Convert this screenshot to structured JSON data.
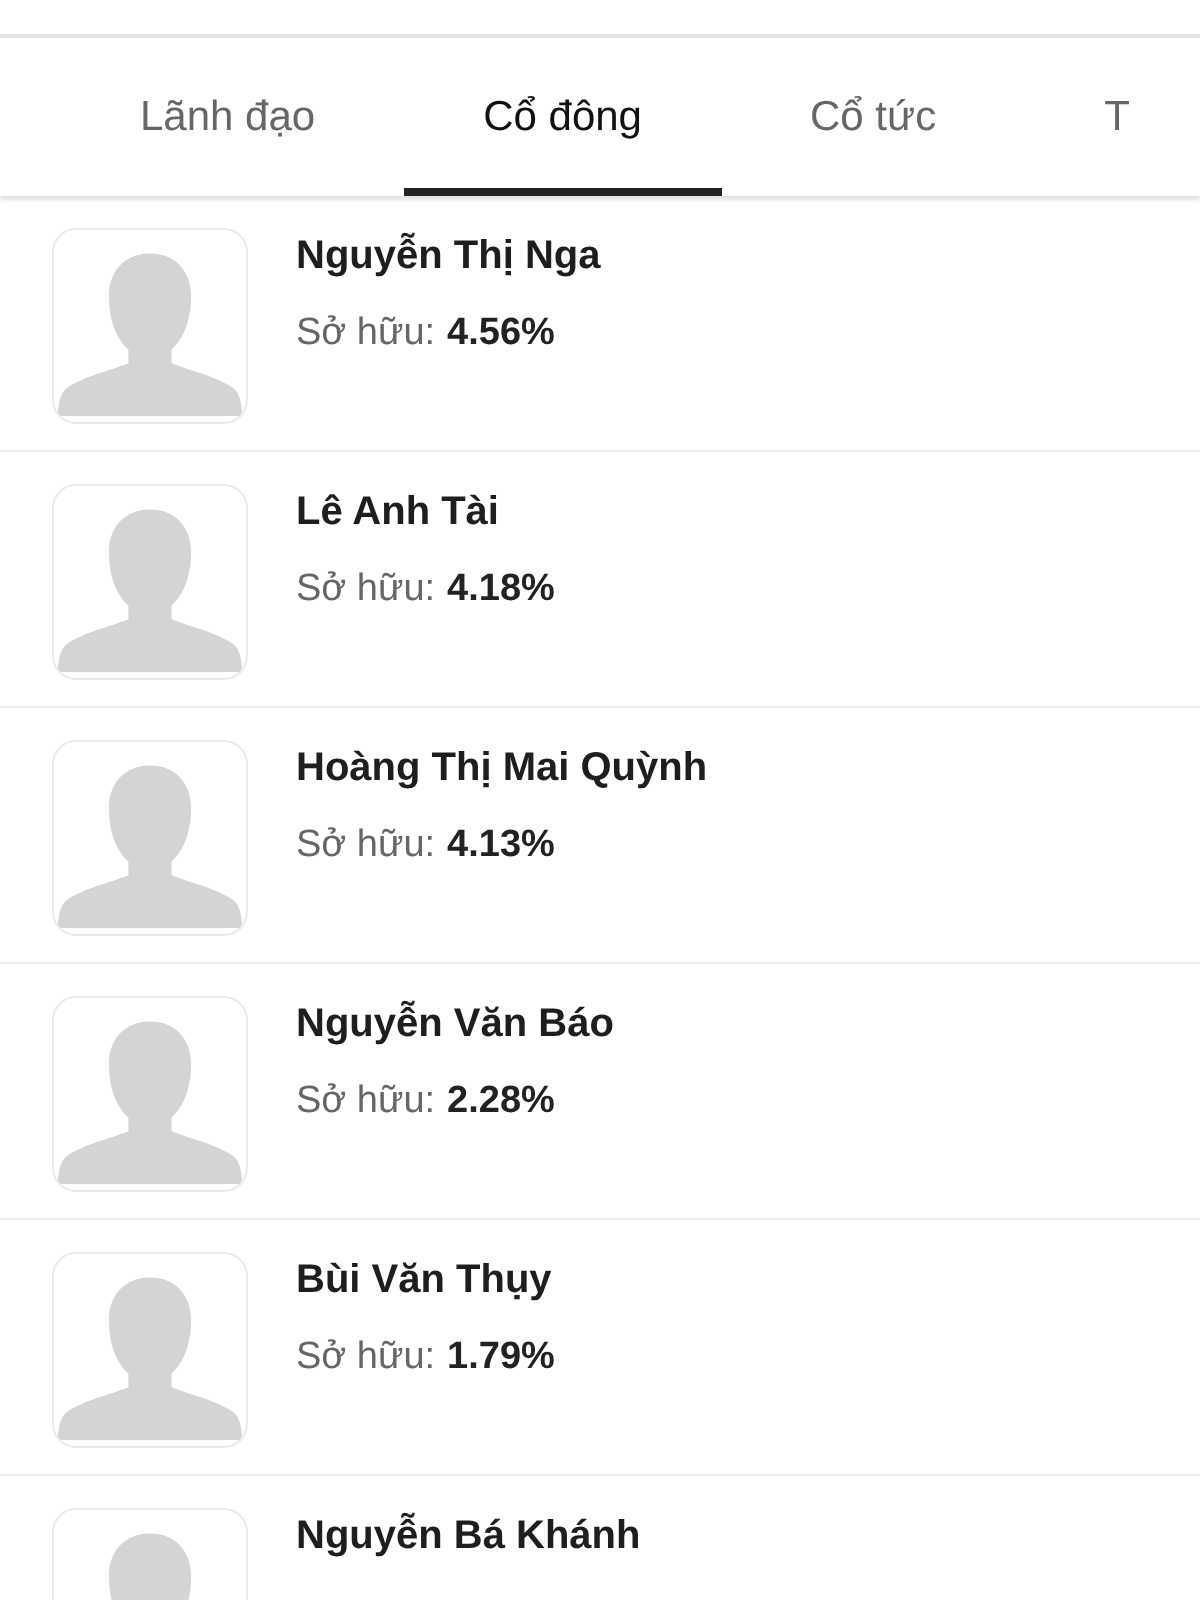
{
  "tabs": [
    {
      "label": "Lãnh đạo",
      "selected": false
    },
    {
      "label": "Cổ đông",
      "selected": true
    },
    {
      "label": "Cổ tức",
      "selected": false
    },
    {
      "label": "T",
      "selected": false
    }
  ],
  "shareholders": [
    {
      "name": "Nguyễn Thị Nga",
      "ownership_label": "Sở hữu:",
      "ownership": "4.56%"
    },
    {
      "name": "Lê Anh Tài",
      "ownership_label": "Sở hữu:",
      "ownership": "4.18%"
    },
    {
      "name": "Hoàng Thị Mai Quỳnh",
      "ownership_label": "Sở hữu:",
      "ownership": "4.13%"
    },
    {
      "name": "Nguyễn Văn Báo",
      "ownership_label": "Sở hữu:",
      "ownership": "2.28%"
    },
    {
      "name": "Bùi Văn Thụy",
      "ownership_label": "Sở hữu:",
      "ownership": "1.79%"
    },
    {
      "name": "Nguyễn Bá Khánh"
    }
  ]
}
